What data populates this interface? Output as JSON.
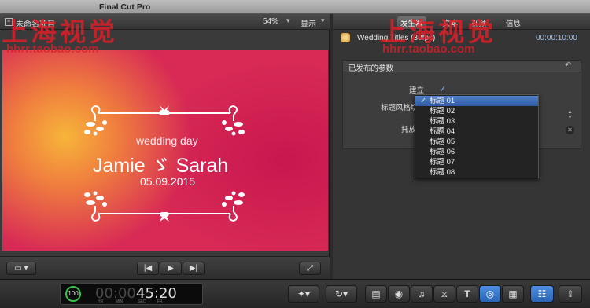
{
  "app": {
    "title": "Final Cut Pro"
  },
  "viewer": {
    "project_name": "未命名项目",
    "zoom": "54%",
    "display_label": "显示",
    "title_card": {
      "line1": "wedding day",
      "names": "Jamie ゞ Sarah",
      "date": "05.09.2015"
    },
    "buttons": {
      "skip_back": "|◀",
      "play": "▶",
      "skip_forward": "▶|",
      "fullscreen": "⤢"
    }
  },
  "inspector": {
    "tabs": [
      "发生器",
      "文本",
      "视频",
      "信息"
    ],
    "active_tab": 0,
    "clip_name": "Wedding Titles (30fps)",
    "clip_time": "00:00:10:00",
    "published_params_title": "已发布的参数",
    "params": {
      "build_label": "建立",
      "build_checked": true,
      "style_label": "标题风格切",
      "drag_label": "托放"
    },
    "style_dropdown": {
      "selected": 0,
      "options": [
        "标题 01",
        "标题 02",
        "标题 03",
        "标题 04",
        "标题 05",
        "标题 06",
        "标题 07",
        "标题 08"
      ]
    }
  },
  "toolbar": {
    "timecode": {
      "dial": "100",
      "dim_digits": "00:00",
      "main_digits": "45:20",
      "units": [
        "HR",
        "MIN",
        "SEC",
        "FR"
      ]
    },
    "icons": [
      "magic-wand-icon",
      "retime-icon",
      "clip-browser-icon",
      "photo-icon",
      "music-icon",
      "transitions-icon",
      "text-icon",
      "generators-icon",
      "themes-icon",
      "inspector-toggle-icon",
      "share-icon"
    ]
  },
  "watermark": {
    "left_text": "上海视觉",
    "right_text": "上海视觉",
    "left_url": "hhrr.taobao.com",
    "right_url": "hhrr.taobao.com"
  },
  "colors": {
    "selection_blue": "#2d5ba6",
    "timecode_highlight": "#9cc3ef",
    "watermark_red": "#dc1e28",
    "title_bg_magenta": "#d42a54",
    "title_bg_orange": "#f7b53a"
  }
}
